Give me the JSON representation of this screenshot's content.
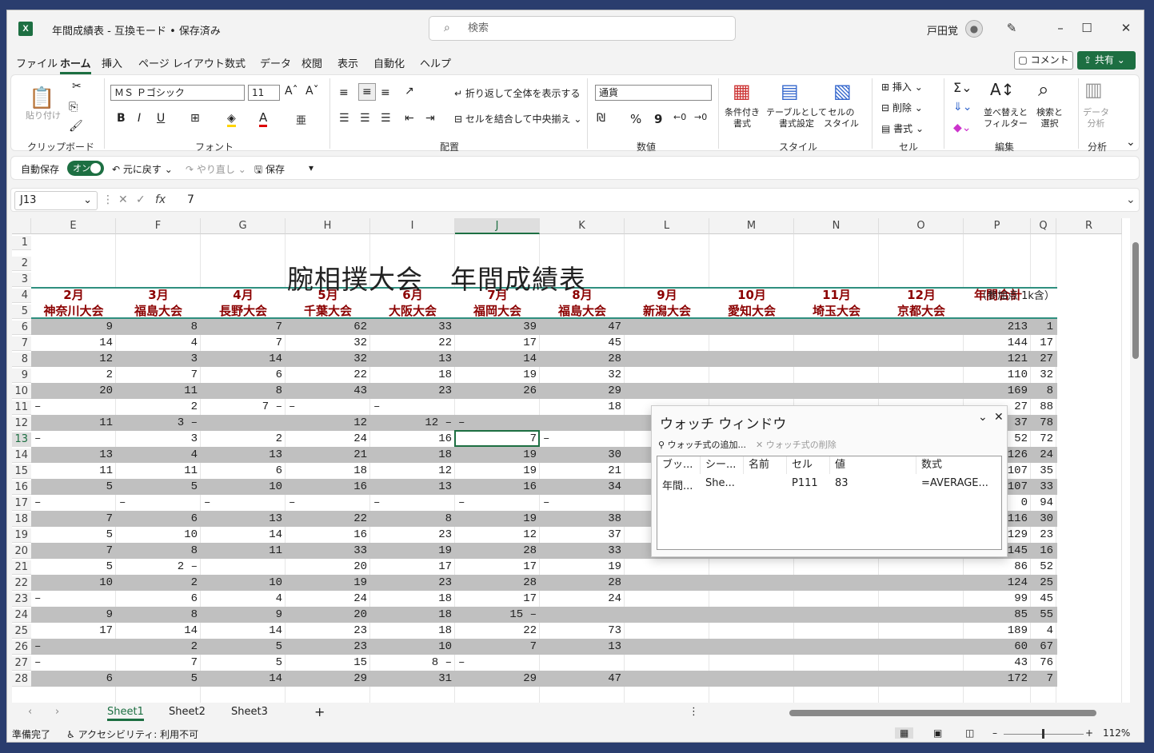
{
  "app": {
    "title": "年間成績表 - 互換モード • 保存済み",
    "search_placeholder": "検索",
    "user": "戸田覚"
  },
  "menu": [
    "ファイル",
    "ホーム",
    "挿入",
    "ページ レイアウト",
    "数式",
    "データ",
    "校閲",
    "表示",
    "自動化",
    "ヘルプ"
  ],
  "menu_active": "ホーム",
  "header_buttons": {
    "comment": "コメント",
    "share": "共有"
  },
  "ribbon": {
    "clipboard": {
      "paste": "貼り付け",
      "group": "クリップボード"
    },
    "font": {
      "name": "ＭＳ Ｐゴシック",
      "size": "11",
      "group": "フォント",
      "bold": "B",
      "italic": "I",
      "underline": "U"
    },
    "alignment": {
      "wrap": "折り返して全体を表示する",
      "merge": "セルを結合して中央揃え",
      "group": "配置"
    },
    "number": {
      "format": "通貨",
      "percent": "%",
      "comma": "9",
      "group": "数値"
    },
    "styles": {
      "cond": "条件付き\n書式",
      "table": "テーブルとして\n書式設定",
      "cell": "セルの\nスタイル",
      "group": "スタイル"
    },
    "cells": {
      "insert": "挿入",
      "delete": "削除",
      "format": "書式",
      "group": "セル"
    },
    "editing": {
      "sort": "並べ替えと\nフィルター",
      "find": "検索と\n選択",
      "group": "編集"
    },
    "analysis": {
      "analyze": "データ\n分析",
      "group": "分析"
    }
  },
  "quickbar": {
    "autosave": "自動保存",
    "toggle": "オン",
    "undo": "元に戻す",
    "redo": "やり直し",
    "save": "保存"
  },
  "formula": {
    "cell_ref": "J13",
    "value": "7"
  },
  "columns": [
    "E",
    "F",
    "G",
    "H",
    "I",
    "J",
    "K",
    "L",
    "M",
    "N",
    "O",
    "P",
    "Q",
    "R"
  ],
  "selected_col": "J",
  "rows": [
    "1",
    "2",
    "3",
    "4",
    "5",
    "6",
    "7",
    "8",
    "9",
    "10",
    "11",
    "12",
    "13",
    "14",
    "15",
    "16",
    "17",
    "18",
    "19",
    "20",
    "21",
    "22",
    "23",
    "24",
    "25",
    "26",
    "27",
    "28"
  ],
  "selected_row": "13",
  "sheet": {
    "title": "腕相撲大会　年間成績表",
    "note": "（参加点 1k含）",
    "months": [
      "2月",
      "3月",
      "4月",
      "5月",
      "6月",
      "7月",
      "8月",
      "9月",
      "10月",
      "11月",
      "12月",
      "年間合計"
    ],
    "events": [
      "神奈川大会",
      "福島大会",
      "長野大会",
      "千葉大会",
      "大阪大会",
      "福岡大会",
      "福島大会",
      "新潟大会",
      "愛知大会",
      "埼玉大会",
      "京都大会"
    ],
    "data": [
      [
        "9",
        "8",
        "7",
        "62",
        "33",
        "39",
        "47",
        "",
        "",
        "",
        "",
        "213",
        "1"
      ],
      [
        "14",
        "4",
        "7",
        "32",
        "22",
        "17",
        "45",
        "",
        "",
        "",
        "",
        "144",
        "17"
      ],
      [
        "12",
        "3",
        "14",
        "32",
        "13",
        "14",
        "28",
        "",
        "",
        "",
        "",
        "121",
        "27"
      ],
      [
        "2",
        "7",
        "6",
        "22",
        "18",
        "19",
        "32",
        "",
        "",
        "",
        "",
        "110",
        "32"
      ],
      [
        "20",
        "11",
        "8",
        "43",
        "23",
        "26",
        "29",
        "",
        "",
        "",
        "",
        "169",
        "8"
      ],
      [
        "–",
        "2",
        "7 –",
        "–",
        "–",
        "",
        "18",
        "",
        "",
        "",
        "",
        "27",
        "88"
      ],
      [
        "11",
        "3 –",
        "",
        "12",
        "12 –",
        "–",
        "",
        "",
        "",
        "",
        "",
        "37",
        "78"
      ],
      [
        "–",
        "3",
        "2",
        "24",
        "16",
        "7",
        "–",
        "",
        "",
        "",
        "",
        "52",
        "72"
      ],
      [
        "13",
        "4",
        "13",
        "21",
        "18",
        "19",
        "30",
        "",
        "",
        "",
        "",
        "126",
        "24"
      ],
      [
        "11",
        "11",
        "6",
        "18",
        "12",
        "19",
        "21",
        "",
        "",
        "",
        "",
        "107",
        "35"
      ],
      [
        "5",
        "5",
        "10",
        "16",
        "13",
        "16",
        "34",
        "",
        "",
        "",
        "",
        "107",
        "33"
      ],
      [
        "–",
        "–",
        "–",
        "–",
        "–",
        "–",
        "–",
        "",
        "",
        "",
        "",
        "0",
        "94"
      ],
      [
        "7",
        "6",
        "13",
        "22",
        "8",
        "19",
        "38",
        "",
        "",
        "",
        "",
        "116",
        "30"
      ],
      [
        "5",
        "10",
        "14",
        "16",
        "23",
        "12",
        "37",
        "",
        "",
        "",
        "",
        "129",
        "23"
      ],
      [
        "7",
        "8",
        "11",
        "33",
        "19",
        "28",
        "33",
        "",
        "",
        "",
        "",
        "145",
        "16"
      ],
      [
        "5",
        "2 –",
        "",
        "20",
        "17",
        "17",
        "19",
        "",
        "",
        "",
        "",
        "86",
        "52"
      ],
      [
        "10",
        "2",
        "10",
        "19",
        "23",
        "28",
        "28",
        "",
        "",
        "",
        "",
        "124",
        "25"
      ],
      [
        "–",
        "6",
        "4",
        "24",
        "18",
        "17",
        "24",
        "",
        "",
        "",
        "",
        "99",
        "45"
      ],
      [
        "9",
        "8",
        "9",
        "20",
        "18",
        "15 –",
        "",
        "",
        "",
        "",
        "",
        "85",
        "55"
      ],
      [
        "17",
        "14",
        "14",
        "23",
        "18",
        "22",
        "73",
        "",
        "",
        "",
        "",
        "189",
        "4"
      ],
      [
        "–",
        "2",
        "5",
        "23",
        "10",
        "7",
        "13",
        "",
        "",
        "",
        "",
        "60",
        "67"
      ],
      [
        "–",
        "7",
        "5",
        "15",
        "8 –",
        "–",
        "",
        "",
        "",
        "",
        "",
        "43",
        "76"
      ],
      [
        "6",
        "5",
        "14",
        "29",
        "31",
        "29",
        "47",
        "",
        "",
        "",
        "",
        "172",
        "7"
      ]
    ]
  },
  "watch": {
    "title": "ウォッチ ウィンドウ",
    "add": "ウォッチ式の追加...",
    "delete": "ウォッチ式の削除",
    "headers": [
      "ブッ...",
      "シー...",
      "名前",
      "セル",
      "値",
      "数式"
    ],
    "row": [
      "年間...",
      "She...",
      "",
      "P111",
      "83",
      "=AVERAGE..."
    ]
  },
  "tabs": [
    "Sheet1",
    "Sheet2",
    "Sheet3"
  ],
  "status": {
    "ready": "準備完了",
    "accessibility": "アクセシビリティ: 利用不可",
    "zoom": "112%"
  }
}
